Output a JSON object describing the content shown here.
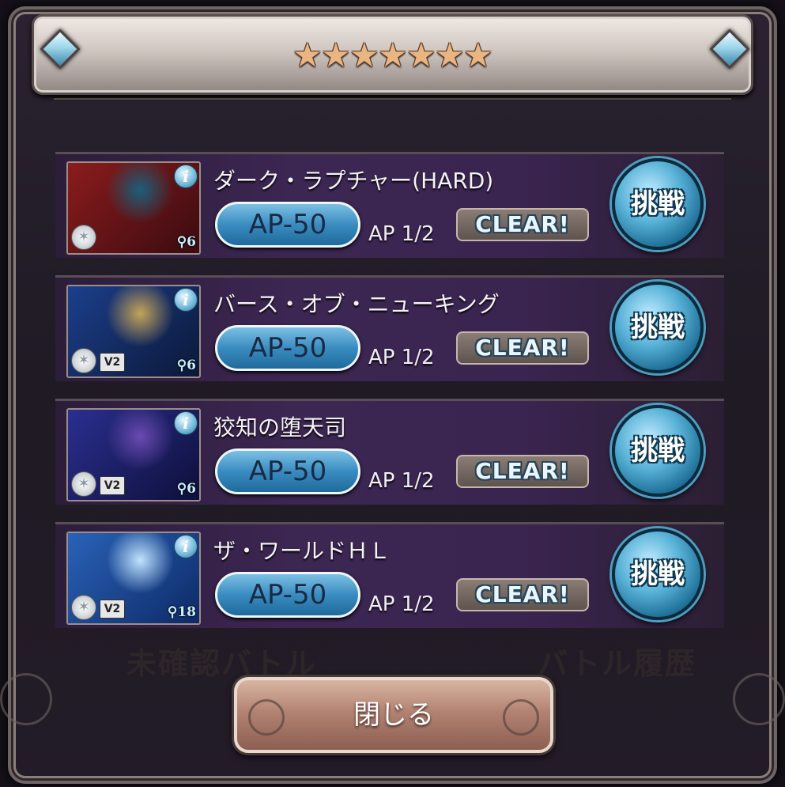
{
  "header": {
    "star_count": 7,
    "star_glyph": "★"
  },
  "background_labels": [
    "未確認バトル",
    "バトル履歴"
  ],
  "quests": [
    {
      "name": "ダーク・ラプチャー(HARD)",
      "ap_cost": "AP-50",
      "ap_count": "AP 1/2",
      "clear_label": "CLEAR!",
      "challenge_label": "挑戦",
      "players": "6",
      "version_badge": "",
      "info_glyph": "i",
      "portrait_colors": [
        "#8b1c1c",
        "#3a0b10",
        "#1b5f7a"
      ]
    },
    {
      "name": "バース・オブ・ニューキング",
      "ap_cost": "AP-50",
      "ap_count": "AP 1/2",
      "clear_label": "CLEAR!",
      "challenge_label": "挑戦",
      "players": "6",
      "version_badge": "V2",
      "info_glyph": "i",
      "portrait_colors": [
        "#1c3f8b",
        "#0b1838",
        "#c4a35a"
      ]
    },
    {
      "name": "狡知の堕天司",
      "ap_cost": "AP-50",
      "ap_count": "AP 1/2",
      "clear_label": "CLEAR!",
      "challenge_label": "挑戦",
      "players": "6",
      "version_badge": "V2",
      "info_glyph": "i",
      "portrait_colors": [
        "#2a2f8f",
        "#0e0f3a",
        "#6a4ab0"
      ]
    },
    {
      "name": "ザ・ワールドＨＬ",
      "ap_cost": "AP-50",
      "ap_count": "AP 1/2",
      "clear_label": "CLEAR!",
      "challenge_label": "挑戦",
      "players": "18",
      "version_badge": "V2",
      "info_glyph": "i",
      "portrait_colors": [
        "#2a62b8",
        "#0d2a66",
        "#bfe3ff"
      ]
    }
  ],
  "close_button": {
    "label": "閉じる"
  },
  "colors": {
    "accent_blue": "#3a8cc0",
    "row_purple": "#3c2652",
    "frame_border": "#6e6463",
    "close_button": "#b38372"
  }
}
